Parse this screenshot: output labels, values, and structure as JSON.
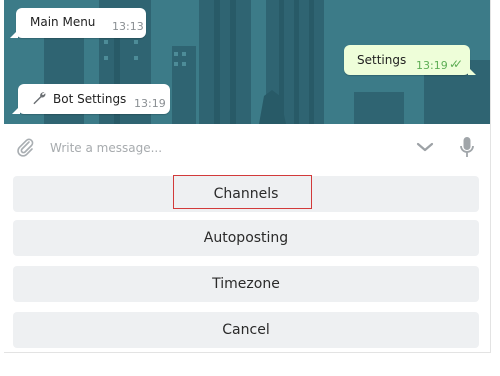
{
  "messages": [
    {
      "text": "Main Menu",
      "time": "13:13",
      "direction": "in"
    },
    {
      "text": "Settings",
      "time": "13:19",
      "direction": "out",
      "read": true
    },
    {
      "text": "Bot Settings",
      "time": "13:19",
      "direction": "in",
      "icon": "wrench-icon"
    }
  ],
  "composer": {
    "placeholder": "Write a message...",
    "value": ""
  },
  "keyboard": {
    "buttons": [
      "Channels",
      "Autoposting",
      "Timezone",
      "Cancel"
    ],
    "highlighted": "Channels"
  },
  "colors": {
    "chat_background": "#3a7886",
    "outgoing_bubble": "#eefed9",
    "read_ticks": "#5fae56",
    "button_bg": "#eef0f2",
    "highlight_border": "#d23a3a"
  }
}
